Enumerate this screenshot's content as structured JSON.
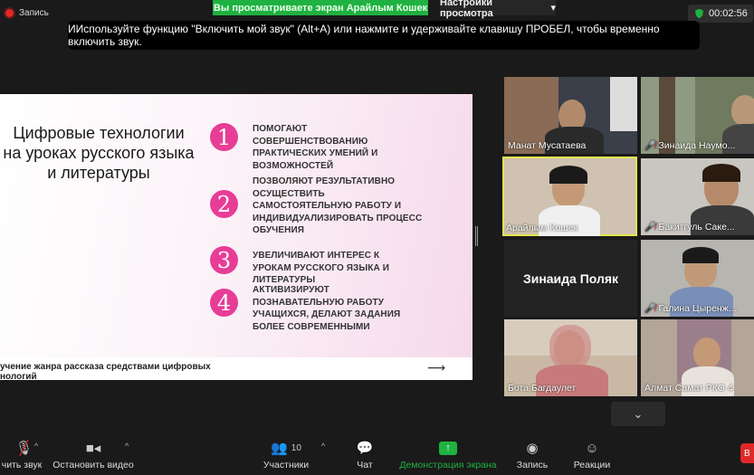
{
  "top": {
    "record_label": "Запись",
    "share_banner": "Вы просматриваете экран Арайлым Кошек",
    "view_options": "Настройки просмотра",
    "timer": "00:02:56",
    "tooltip": "ИИспользуйте функцию \"Включить мой звук\" (Alt+A) или нажмите и удерживайте клавишу ПРОБЕЛ, чтобы временно включить звук."
  },
  "slide": {
    "title": "Цифровые технологии на уроках  русского языка и  литературы",
    "points": [
      {
        "num": "1",
        "text": "ПОМОГАЮТ СОВЕРШЕНСТВОВАНИЮ ПРАКТИЧЕСКИХ УМЕНИЙ И ВОЗМОЖНОСТЕЙ"
      },
      {
        "num": "2",
        "text": "ПОЗВОЛЯЮТ  РЕЗУЛЬТАТИВНО ОСУЩЕСТВИТЬ САМОСТОЯТЕЛЬНУЮ РАБОТУ И ИНДИВИДУАЛИЗИРОВАТЬ ПРОЦЕСС ОБУЧЕНИЯ"
      },
      {
        "num": "3",
        "text": "УВЕЛИЧИВАЮТ ИНТЕРЕС К УРОКАМ РУССКОГО ЯЗЫКА И ЛИТЕРАТУРЫ"
      },
      {
        "num": "4",
        "text": "АКТИВИЗИРУЮТ ПОЗНАВАТЕЛЬНУЮ РАБОТУ УЧАЩИХСЯ,  ДЕЛАЮТ ЗАДАНИЯ БОЛЕЕ СОВРЕМЕННЫМИ"
      }
    ],
    "footer_line1": "учение жанра рассказа средствами цифровых",
    "footer_line2": "нологий",
    "footer_arrow": "⟶"
  },
  "participants": [
    {
      "name": "Манат Мусатаева",
      "muted": false
    },
    {
      "name": "Зинаида Наумо...",
      "muted": true
    },
    {
      "name": "Арайлым Кошек",
      "muted": false
    },
    {
      "name": "Бакитгуль Саке...",
      "muted": true
    },
    {
      "name": "Зинаида Поляк",
      "muted": false
    },
    {
      "name": "Галина Цыренж...",
      "muted": true
    },
    {
      "name": "Бота Багдаулет",
      "muted": false
    },
    {
      "name": "Алмат Самат РКО 4",
      "muted": false
    }
  ],
  "toolbar": {
    "audio": "чить звук",
    "video": "Остановить видео",
    "participants": "Участники",
    "participants_count": "10",
    "chat": "Чат",
    "share": "Демонстрация экрана",
    "record": "Запись",
    "reactions": "Реакции"
  },
  "colors": {
    "accent_green": "#1fb141",
    "slide_pink": "#e83d96",
    "record_red": "#e02828",
    "active_speaker": "#e5e54e"
  }
}
